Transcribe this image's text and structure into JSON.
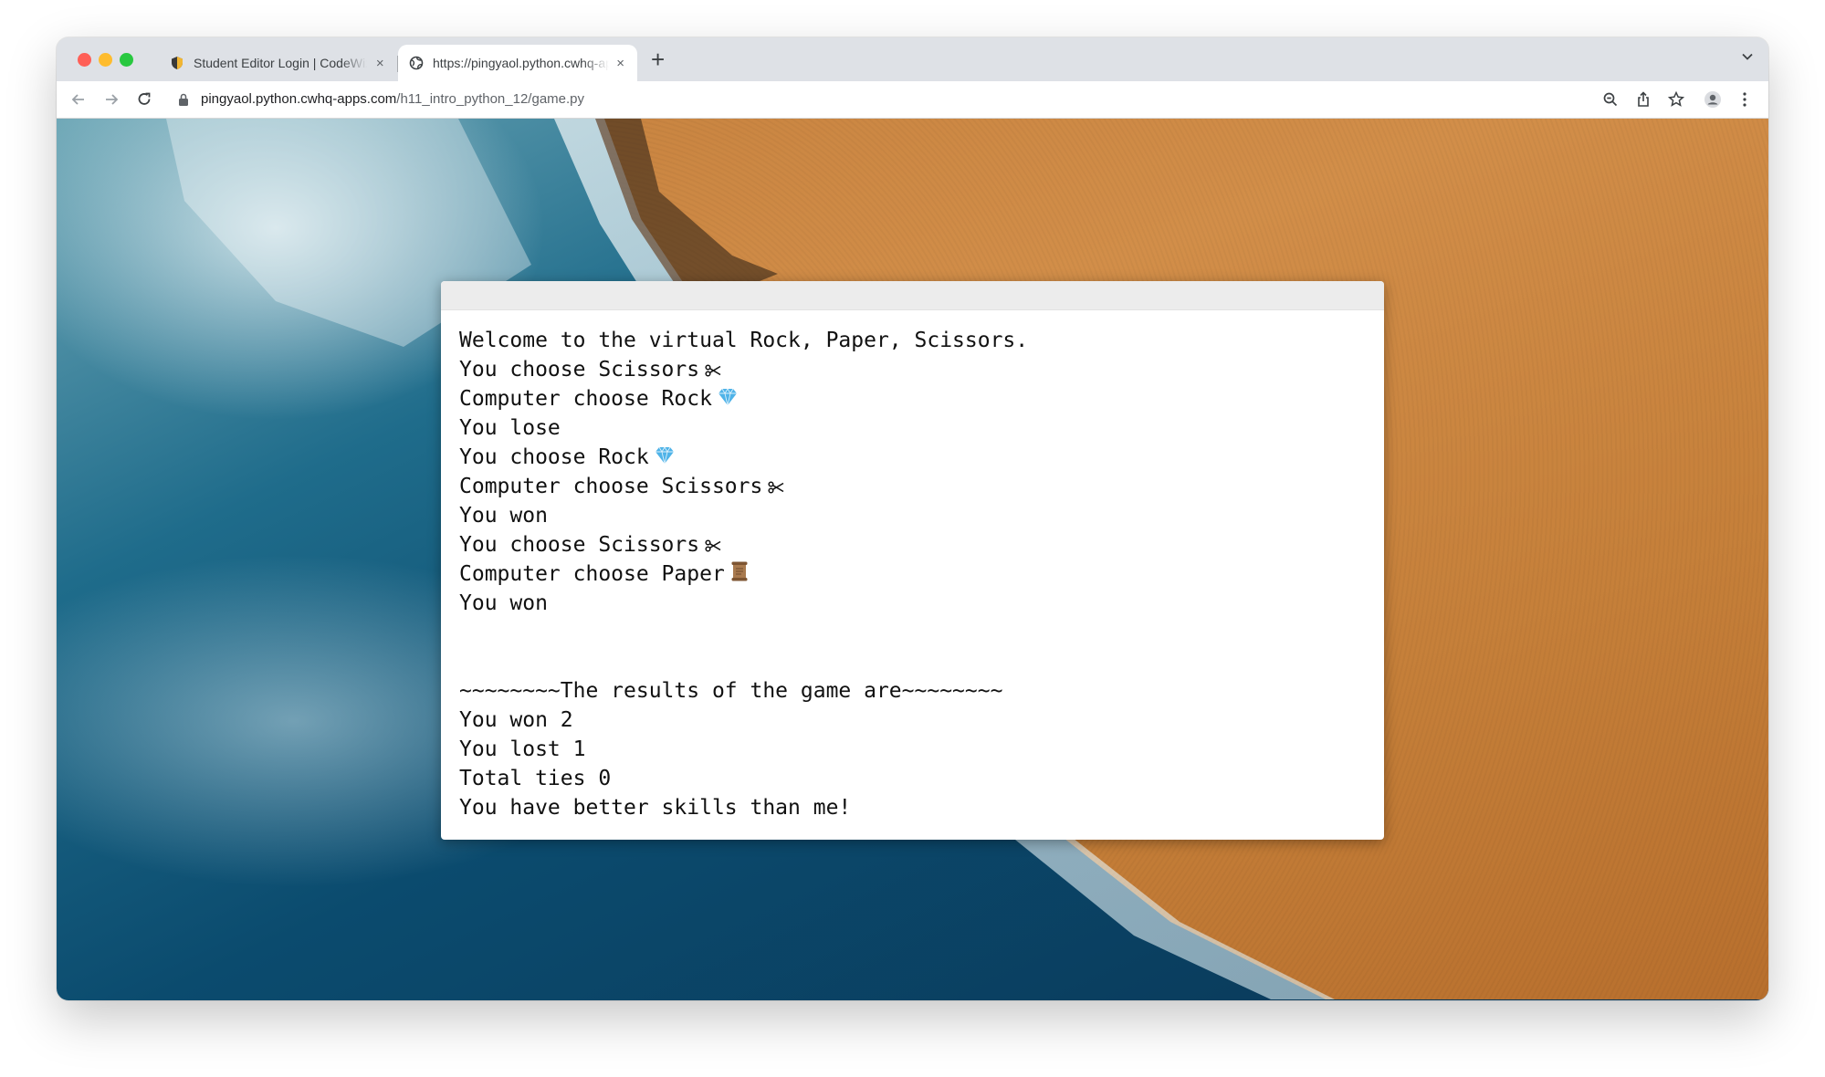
{
  "browser": {
    "tabs": [
      {
        "title": "Student Editor Login | CodeWiz",
        "close": "×"
      },
      {
        "title": "https://pingyaol.python.cwhq-apps.com",
        "close": "×"
      }
    ],
    "new_tab": "+",
    "url_host": "pingyaol.python.cwhq-apps.com",
    "url_path": "/h11_intro_python_12/game.py"
  },
  "console": {
    "lines": [
      {
        "text": "Welcome to the virtual Rock, Paper, Scissors.",
        "icon": ""
      },
      {
        "text": "You choose Scissors",
        "icon": "scissors-icon"
      },
      {
        "text": "Computer choose Rock",
        "icon": "gem-icon"
      },
      {
        "text": "You lose",
        "icon": ""
      },
      {
        "text": "You choose Rock",
        "icon": "gem-icon"
      },
      {
        "text": "Computer choose Scissors",
        "icon": "scissors-icon"
      },
      {
        "text": "You won",
        "icon": ""
      },
      {
        "text": "You choose Scissors",
        "icon": "scissors-icon"
      },
      {
        "text": "Computer choose Paper",
        "icon": "scroll-icon"
      },
      {
        "text": "You won",
        "icon": ""
      },
      {
        "text": "",
        "icon": ""
      },
      {
        "text": "",
        "icon": ""
      },
      {
        "text": "~~~~~~~~The results of the game are~~~~~~~~",
        "icon": ""
      },
      {
        "text": "You won 2",
        "icon": ""
      },
      {
        "text": "You lost 1",
        "icon": ""
      },
      {
        "text": "Total ties 0",
        "icon": ""
      },
      {
        "text": "You have better skills than me!",
        "icon": ""
      }
    ]
  },
  "colors": {
    "gem": "#4fb3e8",
    "scroll": "#a97a4e",
    "traffic_red": "#ff5f57",
    "traffic_yellow": "#febc2e",
    "traffic_green": "#28c840"
  }
}
